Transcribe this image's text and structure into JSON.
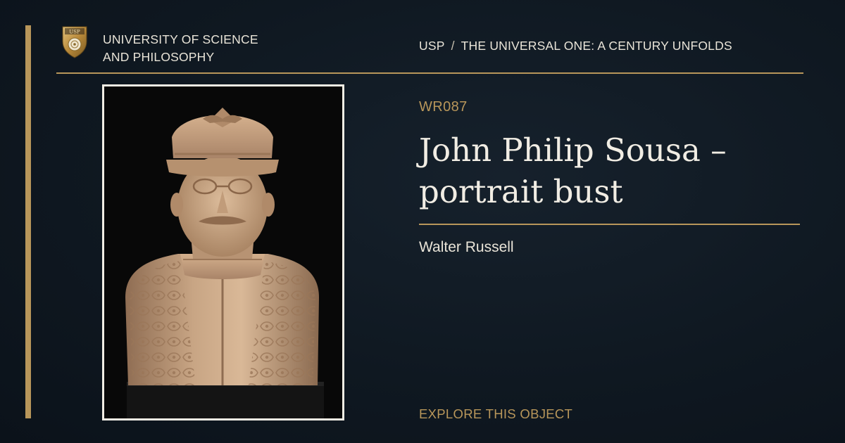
{
  "header": {
    "logo_text": "USP",
    "university_name_line1": "UNIVERSITY OF SCIENCE",
    "university_name_line2": "AND PHILOSOPHY",
    "breadcrumb": {
      "root": "USP",
      "separator": "/",
      "current": "THE UNIVERSAL ONE: A CENTURY UNFOLDS"
    }
  },
  "object": {
    "id": "WR087",
    "title": "John Philip Sousa – portrait bust",
    "artist": "Walter Russell",
    "image_subject": "terracotta-portrait-bust"
  },
  "cta": {
    "label": "EXPLORE THIS OBJECT"
  },
  "colors": {
    "background": "#0f1821",
    "accent_gold": "#b8965a",
    "text_light": "#e9e4d8",
    "title_text": "#f1ede4",
    "frame_border": "#f1ede4"
  }
}
